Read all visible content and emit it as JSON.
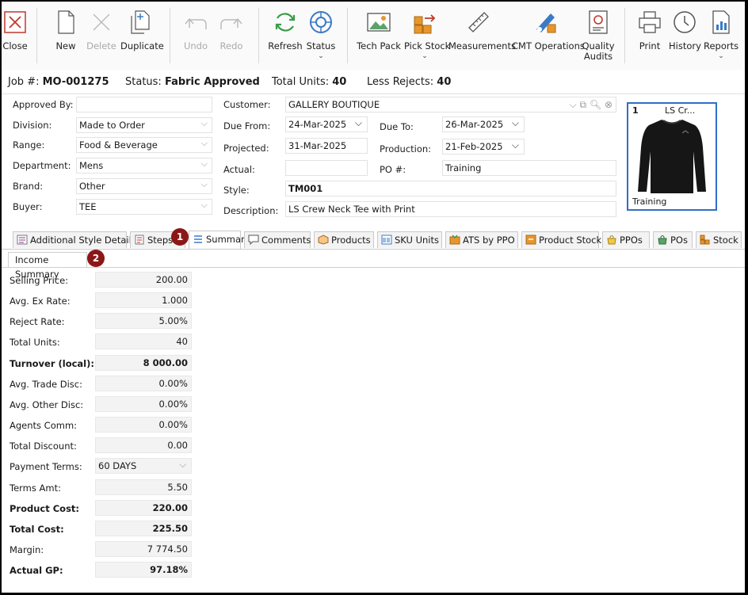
{
  "toolbar": {
    "close": "Close",
    "new": "New",
    "delete": "Delete",
    "duplicate": "Duplicate",
    "undo": "Undo",
    "redo": "Redo",
    "refresh": "Refresh",
    "status": "Status",
    "tech_pack": "Tech Pack",
    "pick_stock": "Pick Stock",
    "measurements": "Measurements",
    "cmt_operations": "CMT Operations",
    "quality_audits_1": "Quality",
    "quality_audits_2": "Audits",
    "print": "Print",
    "history": "History",
    "reports": "Reports"
  },
  "jobbar": {
    "job_label": "Job #:",
    "job_value": "MO-001275",
    "status_label": "Status:",
    "status_value": "Fabric Approved",
    "total_units_label": "Total Units:",
    "total_units_value": "40",
    "less_rejects_label": "Less Rejects:",
    "less_rejects_value": "40"
  },
  "form": {
    "approved_by_label": "Approved By:",
    "approved_by": "",
    "division_label": "Division:",
    "division": "Made to Order",
    "range_label": "Range:",
    "range": "Food & Beverage",
    "department_label": "Department:",
    "department": "Mens",
    "brand_label": "Brand:",
    "brand": "Other",
    "buyer_label": "Buyer:",
    "buyer": "TEE",
    "customer_label": "Customer:",
    "customer": "GALLERY BOUTIQUE",
    "due_from_label": "Due From:",
    "due_from": "24-Mar-2025",
    "due_to_label": "Due To:",
    "due_to": "26-Mar-2025",
    "projected_label": "Projected:",
    "projected": "31-Mar-2025",
    "production_label": "Production:",
    "production": "21-Feb-2025",
    "actual_label": "Actual:",
    "actual": "",
    "po_label": "PO #:",
    "po": "Training",
    "style_label": "Style:",
    "style": "TM001",
    "description_label": "Description:",
    "description": "LS Crew Neck Tee with Print"
  },
  "image_card": {
    "index": "1",
    "title": "LS Cr...",
    "caption": "Training"
  },
  "tabs": {
    "additional_style_details": "Additional Style Details",
    "steps": "Steps",
    "summary": "Summary",
    "comments": "Comments",
    "products": "Products",
    "sku_units": "SKU Units",
    "ats_by_ppo": "ATS by PPO",
    "product_stock": "Product Stock",
    "ppos": "PPOs",
    "pos": "POs",
    "stock": "Stock"
  },
  "subtab": "Income Summary",
  "badges": {
    "one": "1",
    "two": "2"
  },
  "summary": [
    {
      "label": "Selling Price:",
      "value": "200.00",
      "bold": false
    },
    {
      "label": "Avg. Ex Rate:",
      "value": "1.000",
      "bold": false
    },
    {
      "label": "Reject Rate:",
      "value": "5.00%",
      "bold": false
    },
    {
      "label": "Total Units:",
      "value": "40",
      "bold": false
    },
    {
      "label": "Turnover (local):",
      "value": "8 000.00",
      "bold": true
    },
    {
      "label": "Avg. Trade Disc:",
      "value": "0.00%",
      "bold": false
    },
    {
      "label": "Avg. Other Disc:",
      "value": "0.00%",
      "bold": false
    },
    {
      "label": "Agents Comm:",
      "value": "0.00%",
      "bold": false
    },
    {
      "label": "Total Discount:",
      "value": "0.00",
      "bold": false
    },
    {
      "label": "Payment Terms:",
      "value": "60 DAYS",
      "bold": false
    },
    {
      "label": "Terms Amt:",
      "value": "5.50",
      "bold": false
    },
    {
      "label": "Product Cost:",
      "value": "220.00",
      "bold": true
    },
    {
      "label": "Total Cost:",
      "value": "225.50",
      "bold": true
    },
    {
      "label": "Margin:",
      "value": "7 774.50",
      "bold": false
    },
    {
      "label": "Actual GP:",
      "value": "97.18%",
      "bold": true
    }
  ],
  "colors": {
    "accent": "#2f6fc8",
    "badge": "#8c1717",
    "icon_green": "#3a9b4a",
    "icon_blue": "#3a7bc8",
    "icon_orange": "#e8962c"
  }
}
